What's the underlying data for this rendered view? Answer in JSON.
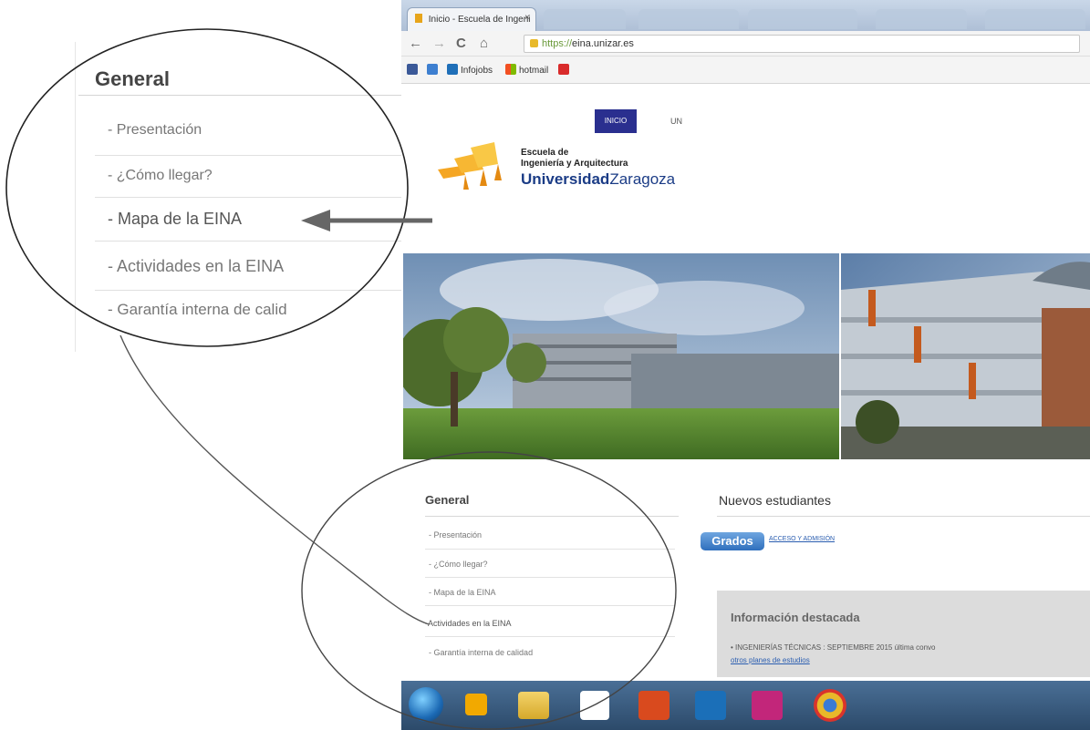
{
  "browser": {
    "tab": {
      "title": "Inicio - Escuela de Ingeni",
      "close": "×"
    },
    "nav": {
      "back": "←",
      "forward": "→",
      "reload": "C",
      "home": "⌂"
    },
    "address": {
      "protocol": "https://",
      "host": "eina.unizar.es"
    },
    "bookmarks": [
      {
        "label": "",
        "color": "#3b5998"
      },
      {
        "label": "",
        "color": "#3d7fd0"
      },
      {
        "label": "Infojobs",
        "color": "#1f6fb8"
      },
      {
        "label": "hotmail",
        "color": "#f2a900"
      },
      {
        "label": "",
        "color": "#d92b2b"
      }
    ]
  },
  "site": {
    "top_nav": {
      "inicio": "INICIO",
      "next": "UN"
    },
    "logo": {
      "line1": "Escuela de",
      "line2": "Ingeniería y Arquitectura",
      "brand_bold": "Universidad",
      "brand_light": "Zaragoza"
    },
    "general": {
      "title": "General",
      "items": [
        "- Presentación",
        "- ¿Cómo llegar?",
        "- Mapa de la EINA",
        "-Actividades en la EINA",
        "- Garantía interna de calidad"
      ]
    },
    "nuevos": {
      "title": "Nuevos estudiantes",
      "button": "Grados",
      "link": "ACCESO Y ADMISIÓN"
    },
    "info": {
      "title": "Información destacada",
      "line": "• INGENIERÍAS TÉCNICAS : SEPTIEMBRE 2015 última convo",
      "link": "otros planes de estudios"
    }
  },
  "zoom": {
    "title": "General",
    "items": [
      "- Presentación",
      "- ¿Cómo llegar?",
      "- Mapa de la EINA",
      "- Actividades en la EINA",
      "- Garantía interna de calid"
    ]
  },
  "colors": {
    "accent_blue": "#2a2f8f",
    "brand_blue": "#1b3c86",
    "arrow": "#666666"
  }
}
